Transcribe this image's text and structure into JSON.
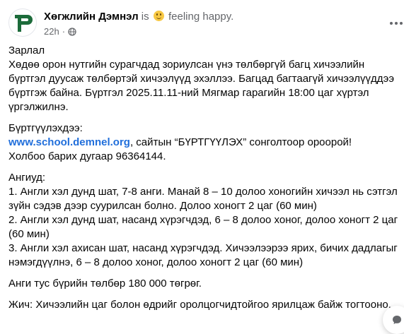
{
  "post": {
    "author": "Хөгжлийн Дэмнэл",
    "is_text": "is",
    "feeling": "feeling happy.",
    "time": "22h",
    "dot": "·"
  },
  "body": {
    "p1": "Зарлал\nХөдөө орон нутгийн сурагчдад зориулсан үнэ төлбөргүй багц хичээлийн бүртгэл дуусаж төлбөртэй хичээлүүд эхэллээ. Багцад багтаагүй хичээлүүддээ бүртгэж байна. Бүртгэл 2025.11.11-ний Мягмар гарагийн 18:00 цаг хүртэл үргэлжилнэ.",
    "p2_intro": "Бүртгүүлэхдээ:",
    "p2_link": "www.school.demnel.org",
    "p2_rest": ", сайтын “БҮРТГҮҮЛЭХ” сонголтоор ороорой!\nХолбоо барих дугаар 96364144.",
    "p3": "Ангиуд:\n1. Англи хэл дунд шат, 7-8 анги. Манай 8 – 10 долоо хоногийн хичээл нь сэтгэл зүйн сэдэв дээр суурилсан болно. Долоо хоногт 2 цаг (60 мин)\n2. Англи хэл дунд шат, насанд хүрэгчдэд, 6 – 8 долоо хоног, долоо хоногт 2 цаг (60 мин)\n3. Англи хэл ахисан шат, насанд хүрэгчдэд. Хичээлээрээ ярих, бичих дадлагыг нэмэгдүүлнэ, 6 – 8 долоо хоног, долоо хоногт 2 цаг (60 мин)",
    "p4": "Анги тус бүрийн төлбөр 180 000 төгрөг.",
    "p5": "Жич: Хичээлийн цаг болон өдрийг оролцогчидтойгоо ярилцаж байж тогтооно."
  },
  "colors": {
    "accent": "#216fdb",
    "brand": "#1c6b3a",
    "muted": "#65676b"
  },
  "icons": {
    "privacy": "globe-icon",
    "more": "more-options-icon",
    "emoji": "smiling-face-icon"
  }
}
